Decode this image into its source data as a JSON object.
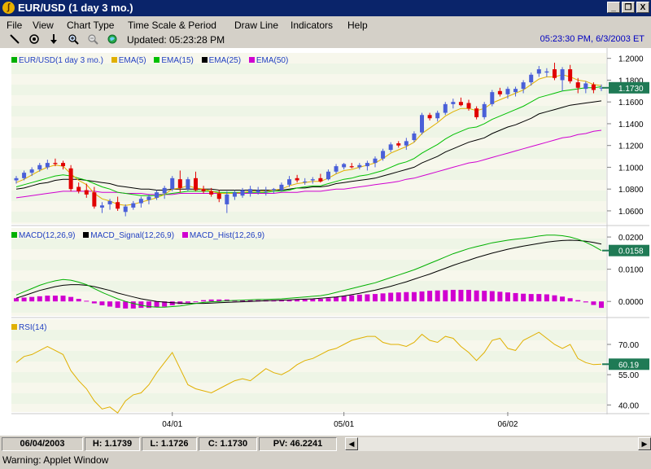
{
  "window": {
    "title": "EUR/USD (1 day  3 mo.)",
    "controls": [
      "_",
      "❐",
      "X"
    ]
  },
  "menu": [
    "File",
    "View",
    "Chart Type",
    "Time Scale & Period",
    "Draw Line",
    "Indicators",
    "Help"
  ],
  "toolbar": {
    "icons": [
      "draw-line-icon",
      "target-icon",
      "down-arrow-icon",
      "zoom-in-icon",
      "zoom-out-icon",
      "globe-icon"
    ],
    "updated": "Updated: 05:23:28 PM",
    "clock": "05:23:30 PM, 6/3/2003 ET"
  },
  "status": {
    "date": "06/04/2003",
    "high": "H: 1.1739",
    "low": "L: 1.1726",
    "close": "C: 1.1730",
    "pv": "PV: 46.2241"
  },
  "warning": "Warning: Applet Window",
  "chart_data": [
    {
      "type": "candlestick",
      "legend": [
        {
          "name": "EUR/USD(1 day  3 mo.)",
          "color": "#00b000"
        },
        {
          "name": "EMA(5)",
          "color": "#e0b000"
        },
        {
          "name": "EMA(15)",
          "color": "#00c000"
        },
        {
          "name": "EMA(25)",
          "color": "#000000"
        },
        {
          "name": "EMA(50)",
          "color": "#d000d0"
        }
      ],
      "colors": {
        "up": "#4a5fd8",
        "down": "#e00000",
        "ema5": "#e0b000",
        "ema15": "#00c000",
        "ema25": "#000000",
        "ema50": "#d000d0"
      },
      "y_ticks": [
        "1.2000",
        "1.1800",
        "1.1600",
        "1.1400",
        "1.1200",
        "1.1000",
        "1.0800",
        "1.0600"
      ],
      "ylim": [
        1.048,
        1.205
      ],
      "last_value": "1.1730",
      "ohlc": [
        [
          1.088,
          1.092,
          1.085,
          1.09
        ],
        [
          1.09,
          1.097,
          1.088,
          1.095
        ],
        [
          1.095,
          1.1,
          1.092,
          1.098
        ],
        [
          1.098,
          1.104,
          1.096,
          1.102
        ],
        [
          1.1,
          1.107,
          1.098,
          1.104
        ],
        [
          1.104,
          1.108,
          1.101,
          1.103
        ],
        [
          1.104,
          1.106,
          1.098,
          1.101
        ],
        [
          1.099,
          1.102,
          1.078,
          1.08
        ],
        [
          1.082,
          1.086,
          1.076,
          1.078
        ],
        [
          1.079,
          1.085,
          1.072,
          1.075
        ],
        [
          1.077,
          1.082,
          1.062,
          1.064
        ],
        [
          1.063,
          1.068,
          1.058,
          1.065
        ],
        [
          1.066,
          1.071,
          1.061,
          1.069
        ],
        [
          1.068,
          1.073,
          1.06,
          1.062
        ],
        [
          1.059,
          1.066,
          1.055,
          1.064
        ],
        [
          1.063,
          1.069,
          1.061,
          1.067
        ],
        [
          1.067,
          1.073,
          1.063,
          1.071
        ],
        [
          1.07,
          1.075,
          1.066,
          1.073
        ],
        [
          1.072,
          1.079,
          1.07,
          1.077
        ],
        [
          1.076,
          1.083,
          1.071,
          1.081
        ],
        [
          1.08,
          1.092,
          1.078,
          1.09
        ],
        [
          1.089,
          1.097,
          1.077,
          1.081
        ],
        [
          1.08,
          1.091,
          1.078,
          1.089
        ],
        [
          1.09,
          1.096,
          1.078,
          1.079
        ],
        [
          1.08,
          1.083,
          1.076,
          1.078
        ],
        [
          1.078,
          1.081,
          1.073,
          1.075
        ],
        [
          1.076,
          1.079,
          1.068,
          1.071
        ],
        [
          1.066,
          1.078,
          1.058,
          1.075
        ],
        [
          1.073,
          1.079,
          1.07,
          1.077
        ],
        [
          1.074,
          1.081,
          1.072,
          1.079
        ],
        [
          1.076,
          1.083,
          1.073,
          1.08
        ],
        [
          1.077,
          1.082,
          1.075,
          1.079
        ],
        [
          1.078,
          1.082,
          1.074,
          1.078
        ],
        [
          1.079,
          1.081,
          1.076,
          1.08
        ],
        [
          1.079,
          1.086,
          1.078,
          1.084
        ],
        [
          1.084,
          1.092,
          1.082,
          1.089
        ],
        [
          1.09,
          1.093,
          1.086,
          1.088
        ],
        [
          1.087,
          1.09,
          1.084,
          1.087
        ],
        [
          1.088,
          1.091,
          1.085,
          1.089
        ],
        [
          1.09,
          1.094,
          1.086,
          1.087
        ],
        [
          1.089,
          1.098,
          1.088,
          1.096
        ],
        [
          1.096,
          1.103,
          1.094,
          1.101
        ],
        [
          1.1,
          1.104,
          1.098,
          1.103
        ],
        [
          1.101,
          1.104,
          1.099,
          1.1
        ],
        [
          1.1,
          1.104,
          1.098,
          1.102
        ],
        [
          1.101,
          1.106,
          1.097,
          1.104
        ],
        [
          1.104,
          1.11,
          1.1,
          1.108
        ],
        [
          1.108,
          1.117,
          1.106,
          1.115
        ],
        [
          1.116,
          1.123,
          1.114,
          1.121
        ],
        [
          1.122,
          1.124,
          1.118,
          1.12
        ],
        [
          1.12,
          1.127,
          1.116,
          1.124
        ],
        [
          1.125,
          1.133,
          1.123,
          1.131
        ],
        [
          1.132,
          1.15,
          1.13,
          1.148
        ],
        [
          1.148,
          1.15,
          1.143,
          1.145
        ],
        [
          1.145,
          1.152,
          1.142,
          1.15
        ],
        [
          1.15,
          1.16,
          1.148,
          1.158
        ],
        [
          1.158,
          1.163,
          1.154,
          1.16
        ],
        [
          1.16,
          1.164,
          1.156,
          1.157
        ],
        [
          1.159,
          1.162,
          1.152,
          1.154
        ],
        [
          1.154,
          1.156,
          1.144,
          1.146
        ],
        [
          1.146,
          1.16,
          1.144,
          1.158
        ],
        [
          1.158,
          1.171,
          1.156,
          1.169
        ],
        [
          1.17,
          1.173,
          1.165,
          1.167
        ],
        [
          1.167,
          1.174,
          1.163,
          1.172
        ],
        [
          1.169,
          1.174,
          1.165,
          1.172
        ],
        [
          1.172,
          1.18,
          1.168,
          1.178
        ],
        [
          1.178,
          1.187,
          1.175,
          1.185
        ],
        [
          1.186,
          1.193,
          1.183,
          1.19
        ],
        [
          1.187,
          1.191,
          1.183,
          1.188
        ],
        [
          1.19,
          1.196,
          1.18,
          1.182
        ],
        [
          1.18,
          1.192,
          1.17,
          1.19
        ],
        [
          1.19,
          1.194,
          1.177,
          1.179
        ],
        [
          1.178,
          1.182,
          1.168,
          1.173
        ],
        [
          1.172,
          1.179,
          1.168,
          1.177
        ],
        [
          1.176,
          1.178,
          1.168,
          1.171
        ],
        [
          1.173,
          1.176,
          1.17,
          1.173
        ]
      ],
      "ema5": [
        1.086,
        1.089,
        1.093,
        1.097,
        1.1,
        1.102,
        1.101,
        1.094,
        1.088,
        1.084,
        1.076,
        1.071,
        1.069,
        1.066,
        1.065,
        1.066,
        1.068,
        1.07,
        1.072,
        1.075,
        1.08,
        1.081,
        1.083,
        1.081,
        1.08,
        1.078,
        1.076,
        1.076,
        1.076,
        1.077,
        1.078,
        1.078,
        1.078,
        1.079,
        1.08,
        1.083,
        1.085,
        1.086,
        1.087,
        1.087,
        1.09,
        1.094,
        1.097,
        1.098,
        1.1,
        1.102,
        1.104,
        1.108,
        1.113,
        1.116,
        1.119,
        1.123,
        1.131,
        1.136,
        1.141,
        1.147,
        1.151,
        1.154,
        1.154,
        1.152,
        1.154,
        1.159,
        1.162,
        1.165,
        1.168,
        1.171,
        1.176,
        1.181,
        1.183,
        1.183,
        1.185,
        1.183,
        1.18,
        1.179,
        1.176,
        1.175
      ],
      "ema15": [
        1.082,
        1.084,
        1.086,
        1.088,
        1.09,
        1.092,
        1.093,
        1.092,
        1.09,
        1.088,
        1.085,
        1.082,
        1.08,
        1.077,
        1.076,
        1.075,
        1.074,
        1.074,
        1.074,
        1.075,
        1.076,
        1.077,
        1.078,
        1.078,
        1.078,
        1.078,
        1.077,
        1.077,
        1.077,
        1.077,
        1.077,
        1.077,
        1.077,
        1.078,
        1.078,
        1.079,
        1.081,
        1.082,
        1.083,
        1.083,
        1.085,
        1.087,
        1.089,
        1.09,
        1.092,
        1.093,
        1.095,
        1.097,
        1.1,
        1.103,
        1.105,
        1.108,
        1.113,
        1.117,
        1.121,
        1.126,
        1.13,
        1.133,
        1.136,
        1.137,
        1.14,
        1.144,
        1.147,
        1.15,
        1.153,
        1.156,
        1.16,
        1.164,
        1.166,
        1.168,
        1.17,
        1.171,
        1.172,
        1.173,
        1.173,
        1.174
      ],
      "ema25": [
        1.08,
        1.081,
        1.083,
        1.085,
        1.086,
        1.088,
        1.089,
        1.089,
        1.089,
        1.088,
        1.087,
        1.086,
        1.085,
        1.083,
        1.082,
        1.081,
        1.08,
        1.08,
        1.079,
        1.079,
        1.08,
        1.08,
        1.08,
        1.08,
        1.08,
        1.08,
        1.079,
        1.079,
        1.079,
        1.079,
        1.079,
        1.079,
        1.079,
        1.079,
        1.079,
        1.08,
        1.081,
        1.081,
        1.082,
        1.082,
        1.083,
        1.085,
        1.086,
        1.087,
        1.088,
        1.089,
        1.09,
        1.092,
        1.094,
        1.096,
        1.098,
        1.1,
        1.104,
        1.107,
        1.11,
        1.114,
        1.117,
        1.12,
        1.123,
        1.125,
        1.127,
        1.131,
        1.134,
        1.137,
        1.139,
        1.142,
        1.145,
        1.149,
        1.151,
        1.153,
        1.155,
        1.157,
        1.158,
        1.159,
        1.16,
        1.161
      ],
      "ema50": [
        1.072,
        1.073,
        1.074,
        1.075,
        1.076,
        1.077,
        1.078,
        1.078,
        1.078,
        1.078,
        1.078,
        1.077,
        1.077,
        1.077,
        1.076,
        1.076,
        1.076,
        1.075,
        1.075,
        1.075,
        1.075,
        1.076,
        1.076,
        1.076,
        1.076,
        1.076,
        1.076,
        1.076,
        1.076,
        1.076,
        1.076,
        1.076,
        1.076,
        1.076,
        1.077,
        1.077,
        1.077,
        1.078,
        1.078,
        1.078,
        1.079,
        1.08,
        1.08,
        1.081,
        1.082,
        1.083,
        1.084,
        1.085,
        1.086,
        1.087,
        1.089,
        1.09,
        1.092,
        1.094,
        1.096,
        1.098,
        1.1,
        1.102,
        1.104,
        1.105,
        1.107,
        1.109,
        1.111,
        1.113,
        1.115,
        1.117,
        1.119,
        1.121,
        1.123,
        1.125,
        1.127,
        1.128,
        1.13,
        1.131,
        1.133,
        1.134
      ]
    },
    {
      "type": "line",
      "legend": [
        {
          "name": "MACD(12,26,9)",
          "color": "#00b000"
        },
        {
          "name": "MACD_Signal(12,26,9)",
          "color": "#000000"
        },
        {
          "name": "MACD_Hist(12,26,9)",
          "color": "#d000d0"
        }
      ],
      "y_ticks": [
        "0.0200",
        "0.0100",
        "0.0000"
      ],
      "ylim": [
        -0.0045,
        0.0228
      ],
      "last_value": "0.0158",
      "macd": [
        0.002,
        0.003,
        0.004,
        0.005,
        0.0058,
        0.0064,
        0.0068,
        0.0066,
        0.006,
        0.0052,
        0.004,
        0.0028,
        0.0018,
        0.0008,
        0.0,
        -0.0006,
        -0.0012,
        -0.0016,
        -0.0018,
        -0.0018,
        -0.0016,
        -0.0014,
        -0.001,
        -0.0006,
        -0.0003,
        -0.0001,
        0.0,
        0.0002,
        0.0003,
        0.0004,
        0.0005,
        0.0006,
        0.0006,
        0.0007,
        0.0008,
        0.001,
        0.0012,
        0.0014,
        0.0016,
        0.0018,
        0.0022,
        0.0028,
        0.0034,
        0.004,
        0.0046,
        0.0052,
        0.0058,
        0.0066,
        0.0074,
        0.0082,
        0.009,
        0.0098,
        0.0108,
        0.0118,
        0.0128,
        0.0138,
        0.0148,
        0.0156,
        0.0164,
        0.017,
        0.0176,
        0.0182,
        0.0186,
        0.019,
        0.0193,
        0.0196,
        0.0199,
        0.0203,
        0.0206,
        0.0206,
        0.0204,
        0.02,
        0.0193,
        0.0184,
        0.0172,
        0.0158
      ],
      "signal": [
        0.001,
        0.0018,
        0.0026,
        0.0034,
        0.004,
        0.0046,
        0.005,
        0.0052,
        0.0052,
        0.005,
        0.0046,
        0.004,
        0.0034,
        0.0026,
        0.002,
        0.0014,
        0.0008,
        0.0004,
        0.0,
        -0.0002,
        -0.0004,
        -0.0005,
        -0.0006,
        -0.0006,
        -0.0006,
        -0.0005,
        -0.0004,
        -0.0003,
        -0.0002,
        -0.0001,
        0.0,
        0.0001,
        0.0002,
        0.0003,
        0.0004,
        0.0005,
        0.0006,
        0.0007,
        0.0008,
        0.001,
        0.0012,
        0.0014,
        0.0017,
        0.0021,
        0.0025,
        0.003,
        0.0035,
        0.0041,
        0.0047,
        0.0054,
        0.0061,
        0.0069,
        0.0077,
        0.0085,
        0.0094,
        0.0103,
        0.0112,
        0.012,
        0.0128,
        0.0136,
        0.0143,
        0.015,
        0.0156,
        0.0162,
        0.0167,
        0.0172,
        0.0176,
        0.018,
        0.0184,
        0.0187,
        0.0189,
        0.019,
        0.0189,
        0.0187,
        0.0183,
        0.0178
      ],
      "hist": [
        0.001,
        0.0012,
        0.0014,
        0.0016,
        0.0018,
        0.0018,
        0.0018,
        0.0014,
        0.0008,
        0.0002,
        -0.0006,
        -0.0012,
        -0.0016,
        -0.002,
        -0.0022,
        -0.0022,
        -0.002,
        -0.002,
        -0.0018,
        -0.0016,
        -0.0012,
        -0.0008,
        -0.0004,
        0.0,
        0.0004,
        0.0006,
        0.0006,
        0.0006,
        0.0004,
        0.0004,
        0.0004,
        0.0004,
        0.0004,
        0.0004,
        0.0004,
        0.0004,
        0.0006,
        0.0006,
        0.0008,
        0.0008,
        0.001,
        0.0014,
        0.0017,
        0.0019,
        0.0021,
        0.0022,
        0.0023,
        0.0025,
        0.0027,
        0.0028,
        0.0029,
        0.0029,
        0.0031,
        0.0033,
        0.0034,
        0.0035,
        0.0036,
        0.0036,
        0.0036,
        0.0034,
        0.0033,
        0.0032,
        0.003,
        0.0028,
        0.0026,
        0.0024,
        0.0023,
        0.0023,
        0.0022,
        0.0019,
        0.0015,
        0.001,
        0.0004,
        -0.0003,
        -0.0011,
        -0.002
      ]
    },
    {
      "type": "line",
      "legend": [
        {
          "name": "RSI(14)",
          "color": "#e0b000"
        }
      ],
      "y_ticks": [
        "70.00",
        "55.00",
        "40.00"
      ],
      "ylim": [
        36.5,
        82.5
      ],
      "last_value": "60.19",
      "rsi": [
        61,
        64,
        65,
        67,
        69,
        67,
        65,
        57,
        52,
        48,
        42,
        38,
        39,
        36,
        42,
        45,
        46,
        50,
        56,
        61,
        66,
        58,
        50,
        48,
        47,
        46,
        48,
        50,
        52,
        53,
        52,
        55,
        58,
        56,
        55,
        57,
        60,
        62,
        63,
        65,
        67,
        68,
        70,
        72,
        73,
        74,
        74,
        71,
        70,
        70,
        69,
        71,
        75,
        72,
        71,
        74,
        73,
        69,
        66,
        62,
        66,
        72,
        73,
        68,
        67,
        72,
        74,
        76,
        73,
        70,
        68,
        70,
        63,
        61,
        60,
        60.19
      ],
      "x_ticks": [
        {
          "label": "04/01",
          "index": 20
        },
        {
          "label": "05/01",
          "index": 42
        },
        {
          "label": "06/02",
          "index": 63
        }
      ]
    }
  ]
}
